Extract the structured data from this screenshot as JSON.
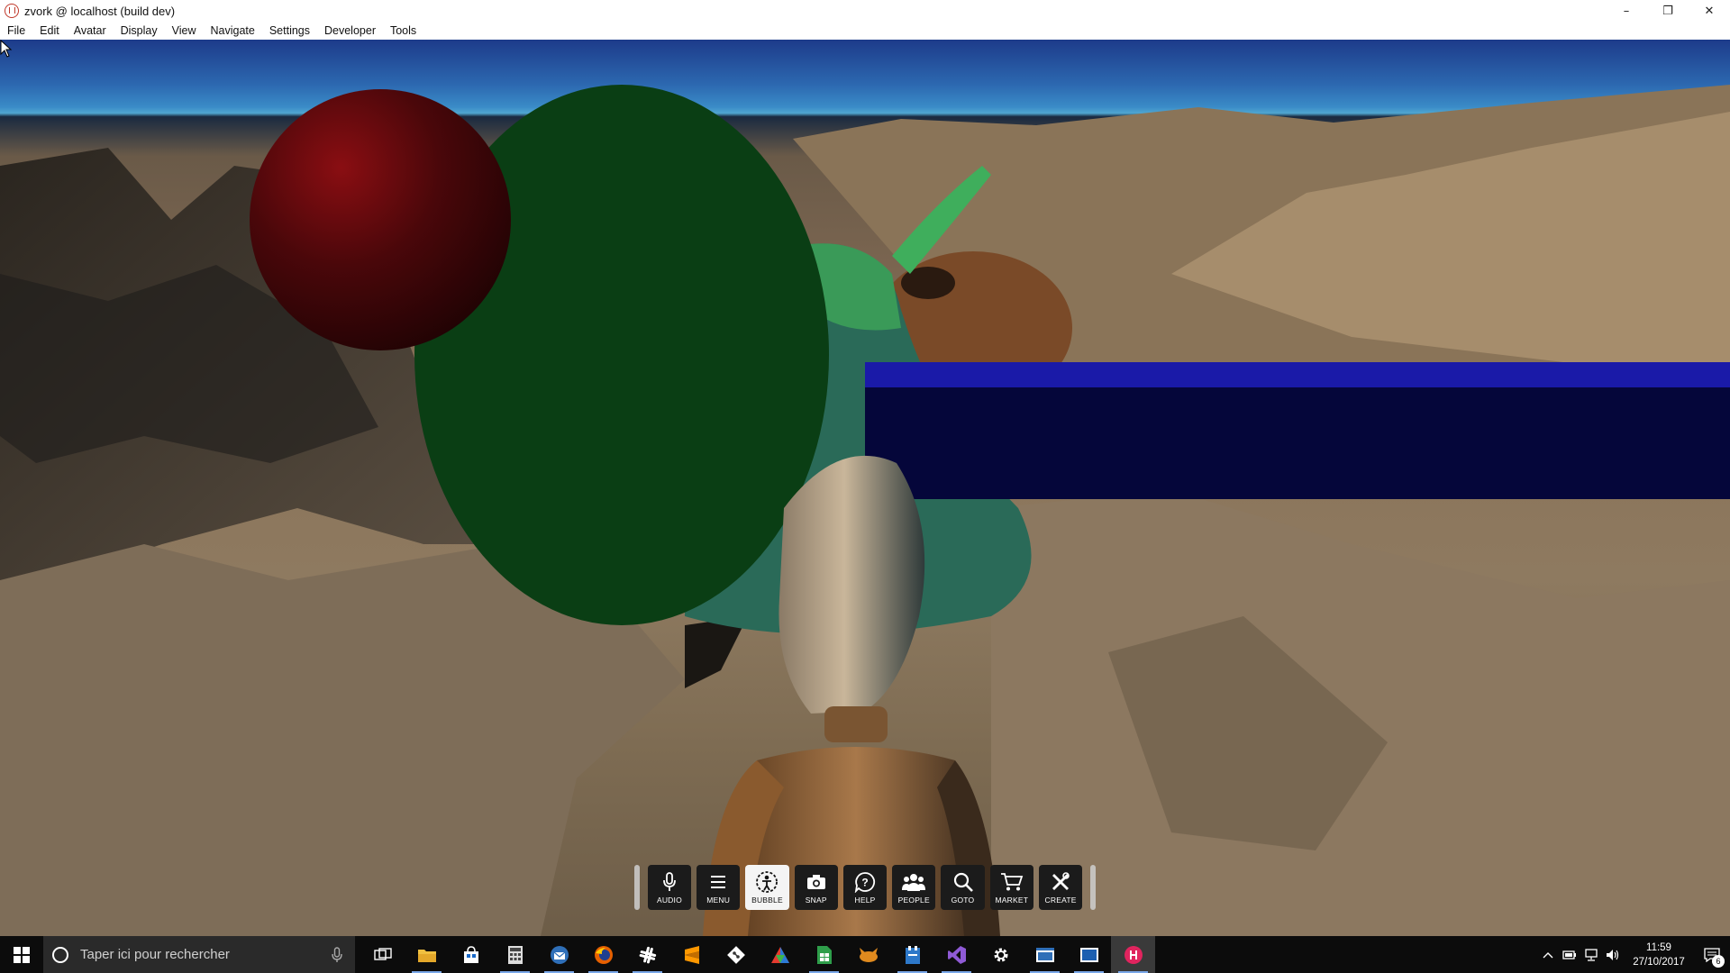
{
  "window": {
    "title": "zvork @ localhost (build dev)",
    "controls": {
      "minimize": "–",
      "restore": "❐",
      "close": "✕"
    }
  },
  "menu": {
    "items": [
      "File",
      "Edit",
      "Avatar",
      "Display",
      "View",
      "Navigate",
      "Settings",
      "Developer",
      "Tools"
    ]
  },
  "toolbar": {
    "buttons": [
      {
        "label": "AUDIO",
        "icon": "microphone-icon",
        "active": false
      },
      {
        "label": "MENU",
        "icon": "hamburger-menu-icon",
        "active": false
      },
      {
        "label": "BUBBLE",
        "icon": "bubble-person-icon",
        "active": true
      },
      {
        "label": "SNAP",
        "icon": "camera-icon",
        "active": false
      },
      {
        "label": "HELP",
        "icon": "help-bubble-icon",
        "active": false
      },
      {
        "label": "PEOPLE",
        "icon": "people-icon",
        "active": false
      },
      {
        "label": "GOTO",
        "icon": "magnifier-icon",
        "active": false
      },
      {
        "label": "MARKET",
        "icon": "cart-icon",
        "active": false
      },
      {
        "label": "CREATE",
        "icon": "tools-icon",
        "active": false
      }
    ]
  },
  "taskbar": {
    "search_placeholder": "Taper ici pour rechercher",
    "apps": [
      "task-view-icon",
      "file-explorer-icon",
      "store-icon",
      "calculator-icon",
      "thunderbird-icon",
      "firefox-icon",
      "slack-icon",
      "sublime-icon",
      "git-icon",
      "triangle-app-icon",
      "spreadsheet-icon",
      "fox-app-icon",
      "notepad-app-icon",
      "visual-studio-icon",
      "settings-gear-icon",
      "window-app-icon",
      "window-app-2-icon",
      "hifi-icon"
    ],
    "clock": {
      "time": "11:59",
      "date": "27/10/2017"
    },
    "notification_count": "6"
  },
  "colors": {
    "toolbar_bg": "#1b1b1b",
    "toolbar_active": "#f4f4f4",
    "taskbar_bg": "#0c0c0c",
    "sky_top": "#1d3b8a",
    "panel_blue": "#1a1aa8"
  }
}
